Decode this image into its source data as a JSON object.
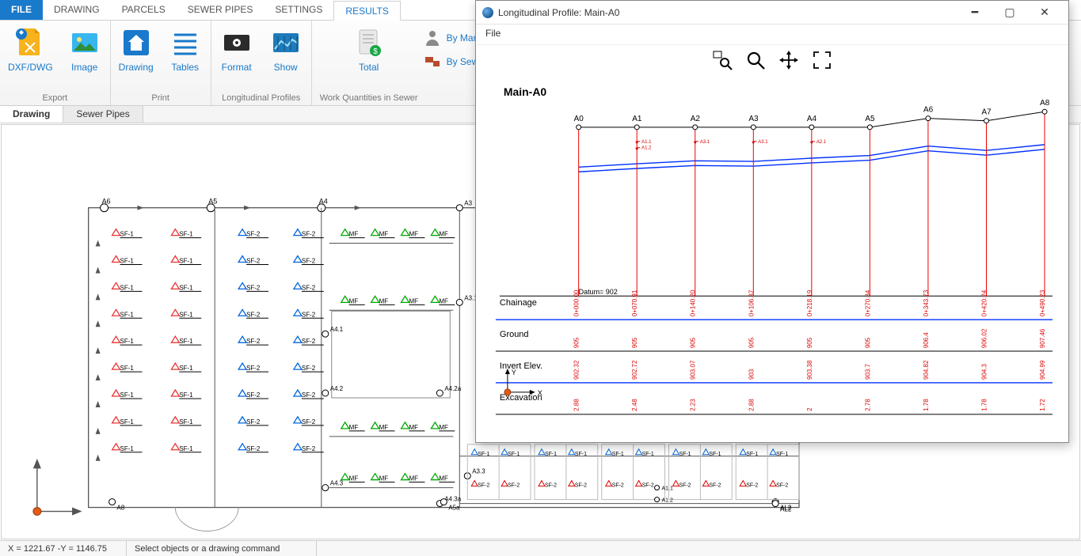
{
  "ribbon": {
    "tabs": [
      "FILE",
      "DRAWING",
      "PARCELS",
      "SEWER PIPES",
      "SETTINGS",
      "RESULTS"
    ],
    "active_tab": "RESULTS",
    "groups": {
      "export": {
        "label": "Export",
        "buttons": [
          {
            "id": "dxf",
            "label": "DXF/DWG"
          },
          {
            "id": "image",
            "label": "Image"
          }
        ]
      },
      "print": {
        "label": "Print",
        "buttons": [
          {
            "id": "drawing",
            "label": "Drawing"
          },
          {
            "id": "tables",
            "label": "Tables"
          }
        ]
      },
      "profiles": {
        "label": "Longitudinal Profiles",
        "buttons": [
          {
            "id": "format",
            "label": "Format"
          },
          {
            "id": "show",
            "label": "Show"
          }
        ]
      },
      "quant": {
        "label": "Work Quantities in Sewer",
        "total": "Total",
        "rows": [
          "By Man",
          "By Sewe"
        ]
      }
    }
  },
  "doc_tabs": {
    "items": [
      "Drawing",
      "Sewer Pipes"
    ],
    "active": "Drawing"
  },
  "canvas": {
    "row_labels_red": "SF-1",
    "row_labels_blue": "SF-2",
    "row_labels_green": "MF",
    "blockA_rows": 9,
    "top_nodes": [
      "A6",
      "A5",
      "A4"
    ],
    "right_nodes": [
      "A3",
      "A3.1",
      "A4.1",
      "A4.2",
      "A4.2a",
      "A4.3",
      "A4.3a",
      "A3.3"
    ],
    "bottom_nodes": [
      "A8",
      "A5a",
      "AL2"
    ],
    "extra_nodes": [
      "A1.1",
      "A1.2"
    ],
    "sf_pairs": [
      "SF-1",
      "SF-1",
      "SF-2",
      "SF-2"
    ]
  },
  "profile": {
    "window_title": "Longitudinal Profile: Main-A0",
    "menu_file": "File",
    "chart_title": "Main-A0",
    "datum_label": "Datum= 902",
    "table_rows": [
      "Chainage",
      "Ground",
      "Invert Elev.",
      "Excavation"
    ],
    "axes_y": "Y",
    "axes_x": "X"
  },
  "statusbar": {
    "coords": "X = 1221.67 -Y = 1146.75",
    "prompt": "Select objects or a drawing command"
  },
  "chart_data": {
    "type": "line",
    "title": "Main-A0",
    "datum": 902,
    "nodes": [
      "A0",
      "A1",
      "A2",
      "A3",
      "A4",
      "A5",
      "A6",
      "A7",
      "A8"
    ],
    "series": [
      {
        "name": "Chainage",
        "values": [
          "0+000.00",
          "0+070.91",
          "0+140.20",
          "0+106.37",
          "0+218.19",
          "0+270.34",
          "0+343.73",
          "0+420.24",
          "0+490.23"
        ]
      },
      {
        "name": "Ground",
        "values": [
          905.0,
          905.0,
          905.0,
          905.0,
          905.0,
          905.0,
          906.4,
          906.02,
          907.46
        ]
      },
      {
        "name": "Invert Elev.",
        "values": [
          902.32,
          902.72,
          903.07,
          903.0,
          903.38,
          903.7,
          904.82,
          904.3,
          904.99
        ]
      },
      {
        "name": "Excavation",
        "values": [
          2.88,
          2.48,
          2.23,
          2.88,
          2.0,
          2.78,
          1.78,
          1.78,
          1.72
        ]
      }
    ],
    "annotations_small": [
      "A1.1",
      "A1.2",
      "A3.1",
      "A3.1",
      "A2.1"
    ],
    "ylabel": "",
    "xlabel": ""
  }
}
